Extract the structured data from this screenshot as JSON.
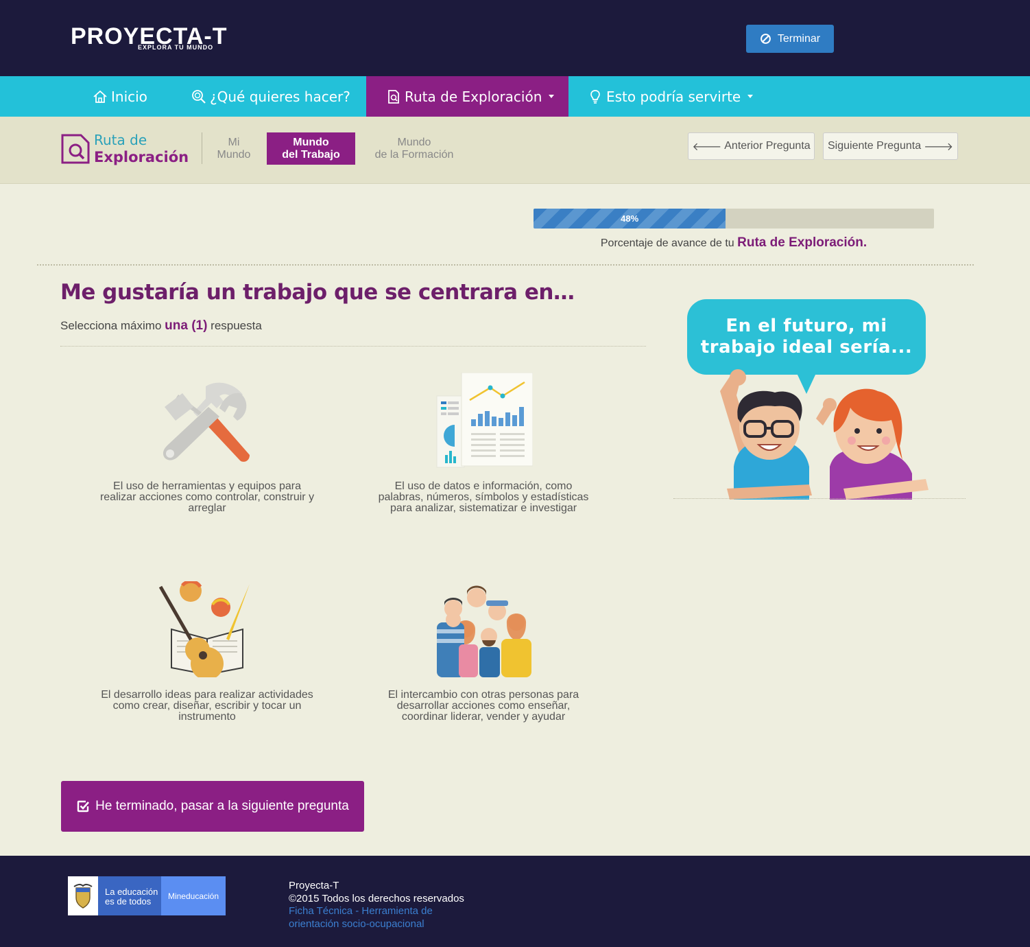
{
  "header": {
    "logo_main": "PROYECTA-T",
    "logo_sub": "EXPLORA TU MUNDO",
    "terminar_label": "Terminar"
  },
  "nav": {
    "items": [
      {
        "label": "Inicio",
        "icon": "home-icon"
      },
      {
        "label": "¿Qué quieres hacer?",
        "icon": "search-icon"
      },
      {
        "label": "Ruta de Exploración",
        "icon": "document-search-icon",
        "active": true
      },
      {
        "label": "Esto podría servirte",
        "icon": "lightbulb-icon"
      }
    ]
  },
  "subnav": {
    "brand_line1": "Ruta de",
    "brand_line2": "Exploración",
    "steps": [
      {
        "line1": "Mi",
        "line2": "Mundo"
      },
      {
        "line1": "Mundo",
        "line2": "del Trabajo",
        "active": true
      },
      {
        "line1": "Mundo",
        "line2": "de la Formación"
      }
    ],
    "prev_label": "Anterior Pregunta",
    "next_label": "Siguiente Pregunta"
  },
  "progress": {
    "percent": 48,
    "label": "48%",
    "caption_prefix": "Porcentaje de avance de tu",
    "caption_bold": "Ruta de Exploración."
  },
  "question": {
    "title": "Me gustaría un trabajo que se centrara en…",
    "sub_prefix": "Selecciona máximo",
    "sub_bold": "una (1)",
    "sub_suffix": "respuesta",
    "options": [
      {
        "icon": "tools-icon",
        "lines": [
          "El uso de herramientas y equipos para",
          "realizar acciones como controlar, construir y",
          "arreglar"
        ]
      },
      {
        "icon": "data-charts-icon",
        "lines": [
          "El uso de datos e información, como",
          "palabras, números, símbolos y estadísticas",
          "para analizar, sistematizar e investigar"
        ]
      },
      {
        "icon": "arts-guitar-icon",
        "lines": [
          "El desarrollo ideas para realizar actividades",
          "como crear, diseñar, escribir y tocar un",
          "instrumento"
        ]
      },
      {
        "icon": "people-group-icon",
        "lines": [
          "El intercambio con otras personas para",
          "desarrollar acciones como enseñar,",
          "coordinar liderar, vender y ayudar"
        ]
      }
    ]
  },
  "side": {
    "bubble_line1": "En el futuro, mi",
    "bubble_line2": "trabajo ideal sería..."
  },
  "finish_label": "He terminado, pasar a la siguiente pregunta",
  "footer": {
    "edu_line1": "La educación",
    "edu_line2": "es de todos",
    "min_label": "Mineducación",
    "line1": "Proyecta-T",
    "line2": "©2015 Todos los derechos reservados",
    "link1": "Ficha Técnica - Herramienta de",
    "link2": "orientación socio-ocupacional"
  },
  "colors": {
    "header_bg": "#1c1a3c",
    "nav_bg": "#23c1d9",
    "accent_purple": "#8b1f84",
    "button_blue": "#2f7cc3",
    "page_bg": "#eeeedf"
  }
}
